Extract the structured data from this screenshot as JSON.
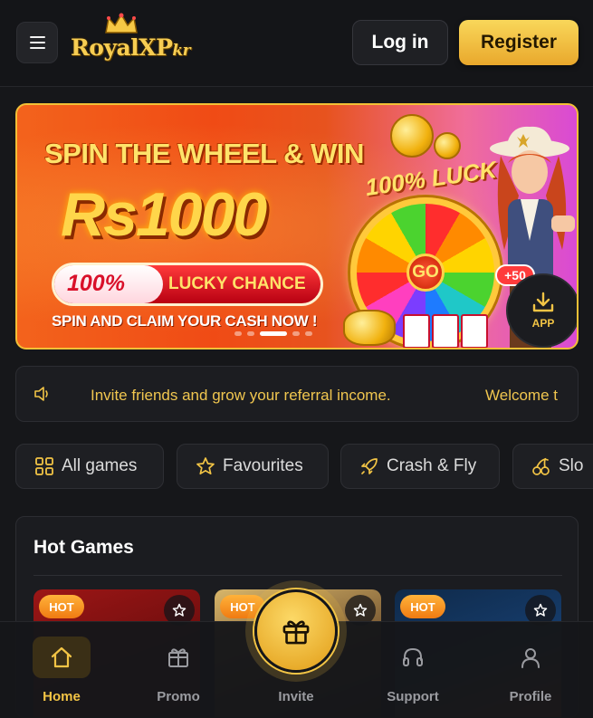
{
  "header": {
    "logo_text": "RoyalXP",
    "logo_suffix": "kr",
    "login_label": "Log in",
    "register_label": "Register"
  },
  "banner": {
    "title": "SPIN THE WHEEL & WIN",
    "amount": "Rs1000",
    "percent": "100%",
    "lucky": "LUCKY CHANCE",
    "subtitle": "SPIN AND CLAIM YOUR CASH NOW !",
    "luck": "100% LUCK",
    "go": "GO",
    "bonus": "+50",
    "app_label": "APP",
    "active_slide": 2
  },
  "marquee": {
    "text": "Invite friends and grow your referral income.",
    "text2": "Welcome t"
  },
  "categories": [
    {
      "label": "All games",
      "icon": "grid-icon"
    },
    {
      "label": "Favourites",
      "icon": "star-icon"
    },
    {
      "label": "Crash & Fly",
      "icon": "rocket-icon"
    },
    {
      "label": "Slo",
      "icon": "cherry-icon"
    }
  ],
  "hot_games": {
    "title": "Hot Games",
    "badge": "HOT"
  },
  "nav": {
    "home": "Home",
    "promo": "Promo",
    "invite": "Invite",
    "support": "Support",
    "profile": "Profile"
  },
  "colors": {
    "accent": "#f2c445",
    "background": "#16171a",
    "hot_badge": "#f07b12"
  }
}
